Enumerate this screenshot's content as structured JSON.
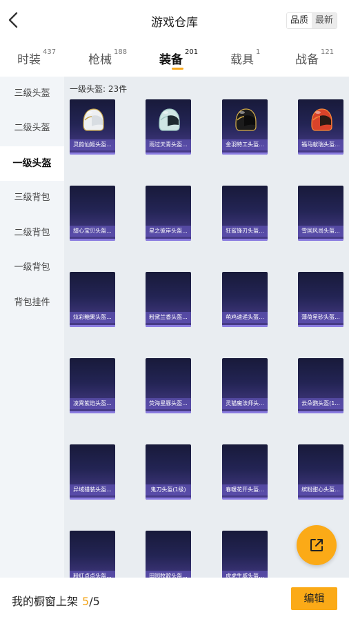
{
  "header": {
    "back_icon": "chevron-left-icon",
    "title": "游戏仓库",
    "sort": {
      "options": [
        "品质",
        "最新"
      ],
      "selected": "品质"
    }
  },
  "tabs": [
    {
      "label": "时装",
      "count": "437"
    },
    {
      "label": "枪械",
      "count": "188"
    },
    {
      "label": "装备",
      "count": "201",
      "active": true
    },
    {
      "label": "载具",
      "count": "1"
    },
    {
      "label": "战备",
      "count": "121"
    }
  ],
  "sidebar": {
    "items": [
      {
        "label": "三级头盔"
      },
      {
        "label": "二级头盔"
      },
      {
        "label": "一级头盔",
        "active": true
      },
      {
        "label": "三级背包"
      },
      {
        "label": "二级背包"
      },
      {
        "label": "一级背包"
      },
      {
        "label": "背包挂件"
      }
    ]
  },
  "content": {
    "header": "一级头盔: 23件",
    "items": [
      {
        "name": "灵韵仙姬头盔...",
        "icon": "white-gold-helmet-icon"
      },
      {
        "name": "雨过天青头盔...",
        "icon": "celadon-helmet-icon"
      },
      {
        "name": "金羽特工头盔...",
        "icon": "black-gold-helmet-icon"
      },
      {
        "name": "福马献瑞头盔...",
        "icon": "red-helmet-icon"
      },
      {
        "name": "甜心宝贝头盔..."
      },
      {
        "name": "星之彼岸头盔..."
      },
      {
        "name": "狂鲨锋刃头盔..."
      },
      {
        "name": "雪国风尚头盔..."
      },
      {
        "name": "炫彩糖果头盔..."
      },
      {
        "name": "粉黛兰香头盔..."
      },
      {
        "name": "萌鸡速递头盔..."
      },
      {
        "name": "薄荷星砂头盔..."
      },
      {
        "name": "凌霄紫焰头盔..."
      },
      {
        "name": "荧海星豚头盔..."
      },
      {
        "name": "灵猫魔法师头..."
      },
      {
        "name": "云朵鹦头盔(1..."
      },
      {
        "name": "异域猎装头盔..."
      },
      {
        "name": "鬼刀头盔(1级)"
      },
      {
        "name": "春暖花开头盔..."
      },
      {
        "name": "缤粉甜心头盔..."
      },
      {
        "name": "粉红点点头盔..."
      },
      {
        "name": "田园牧歌头盔..."
      },
      {
        "name": "虎虎生威头盔..."
      }
    ]
  },
  "fab": {
    "icon": "share-icon"
  },
  "bottom": {
    "label": "我的橱窗上架",
    "current": "5",
    "total": "/5",
    "edit_label": "编辑"
  },
  "colors": {
    "accent": "#fbaa17",
    "card_top": "#181a3a",
    "card_bottom": "#4a3d8c"
  }
}
